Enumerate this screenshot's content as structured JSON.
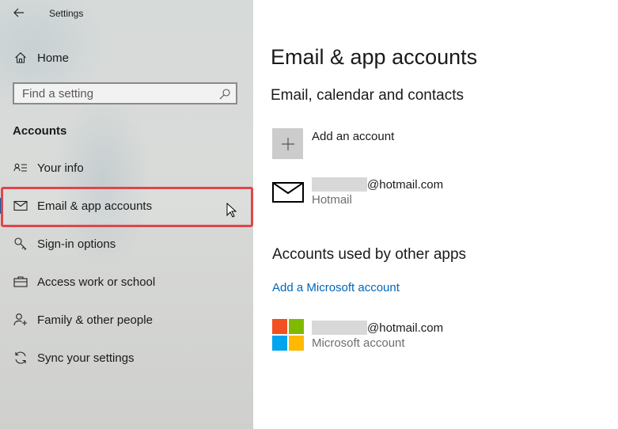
{
  "window": {
    "title": "Settings"
  },
  "sidebar": {
    "home_label": "Home",
    "search_placeholder": "Find a setting",
    "section_label": "Accounts",
    "items": [
      {
        "label": "Your info",
        "icon": "contact-card-icon"
      },
      {
        "label": "Email & app accounts",
        "icon": "mail-icon",
        "selected": true
      },
      {
        "label": "Sign-in options",
        "icon": "key-icon"
      },
      {
        "label": "Access work or school",
        "icon": "briefcase-icon"
      },
      {
        "label": "Family & other people",
        "icon": "add-person-icon"
      },
      {
        "label": "Sync your settings",
        "icon": "sync-icon"
      }
    ]
  },
  "main": {
    "title": "Email & app accounts",
    "email_section": {
      "heading": "Email, calendar and contacts",
      "add_account_label": "Add an account",
      "accounts": [
        {
          "email_suffix": "@hotmail.com",
          "provider": "Hotmail",
          "icon": "envelope-icon"
        }
      ]
    },
    "other_apps_section": {
      "heading": "Accounts used by other apps",
      "add_link": "Add a Microsoft account",
      "accounts": [
        {
          "email_suffix": "@hotmail.com",
          "type": "Microsoft account",
          "icon": "microsoft-logo-icon"
        }
      ]
    }
  },
  "colors": {
    "accent": "#0063b1",
    "link": "#0067b8",
    "highlight_border": "#e0454a",
    "ms_red": "#f25022",
    "ms_green": "#7fba00",
    "ms_blue": "#00a4ef",
    "ms_yellow": "#ffb900"
  }
}
